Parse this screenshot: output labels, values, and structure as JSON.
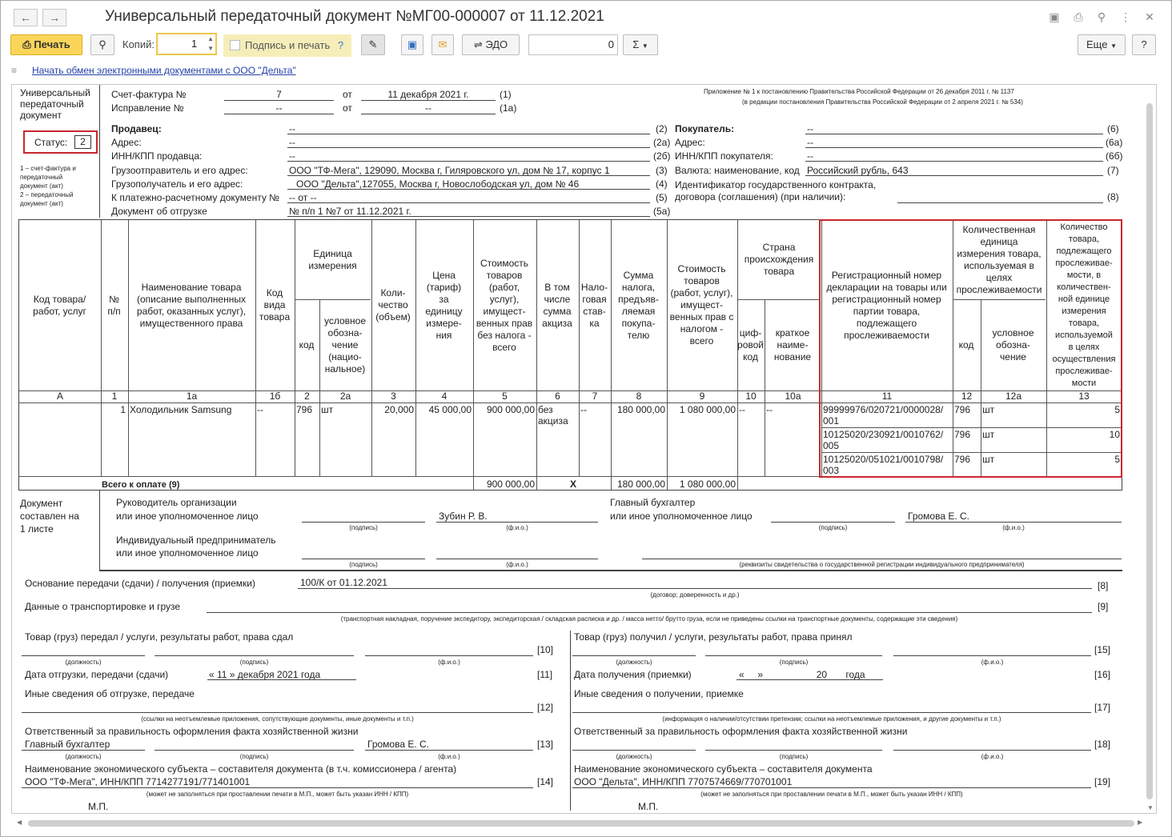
{
  "window": {
    "title": "Универсальный передаточный документ №МГ00-000007 от 11.12.2021"
  },
  "toolbar": {
    "print": "Печать",
    "copies_label": "Копий:",
    "copies_value": "1",
    "sign_print": "Подпись и печать",
    "help_q": "?",
    "edo": "ЭДО",
    "counter": "0",
    "sigma": "Σ",
    "more": "Еще",
    "help": "?"
  },
  "link": "Начать обмен электронными документами с ООО \"Дельта\"",
  "doc": {
    "left_caption": "Универсальный\nпередаточный\nдокумент",
    "status_label": "Статус:",
    "status_value": "2",
    "status_note": "1 – счет-фактура и\nпередаточный\nдокумент (акт)\n2 – передаточный\nдокумент (акт)",
    "appendix1": "Приложение № 1 к постановлению Правительства Российской Федерации от 26 декабря 2011 г. № 1137",
    "appendix2": "(в редакции постановления Правительства Российской Федерации от 2 апреля 2021 г. № 534)",
    "inv_label": "Счет-фактура №",
    "inv_num": "7",
    "ot": "от",
    "inv_date": "11 декабря 2021 г.",
    "n1": "(1)",
    "corr_label": "Исправление №",
    "corr_num": "--",
    "corr_date": "--",
    "n1a": "(1а)",
    "seller_label": "Продавец:",
    "seller": "--",
    "n2": "(2)",
    "addr_label": "Адрес:",
    "addr": "--",
    "n2a": "(2а)",
    "inn_label": "ИНН/КПП продавца:",
    "inn": "--",
    "n2b": "(2б)",
    "shipper_label": "Грузоотправитель и его адрес:",
    "shipper": "ООО \"ТФ-Мега\", 129090, Москва г, Гиляровского ул, дом № 17, корпус 1",
    "n3": "(3)",
    "consignee_label": "Грузополучатель и его адрес:",
    "consignee": "ООО \"Дельта\",127055, Москва г, Новослободская ул, дом № 46",
    "n4": "(4)",
    "payment_label": "К платежно-расчетному документу №",
    "payment": "-- от --",
    "n5": "(5)",
    "shipdoc_label": "Документ об отгрузке",
    "shipdoc": "№ п/п 1 №7 от 11.12.2021 г.",
    "n5a": "(5а)",
    "buyer_label": "Покупатель:",
    "buyer": "--",
    "n6": "(6)",
    "baddr_label": "Адрес:",
    "baddr": "--",
    "n6a": "(6а)",
    "binn_label": "ИНН/КПП покупателя:",
    "binn": "--",
    "n6b": "(6б)",
    "currency_label": "Валюта: наименование, код",
    "currency": "Российский рубль, 643",
    "n7": "(7)",
    "gov_label1": "Идентификатор государственного контракта,",
    "gov_label2": "договора (соглашения) (при наличии):",
    "n8": "(8)"
  },
  "table": {
    "h_code": "Код товара/\nработ, услуг",
    "h_num": "№\nп/п",
    "h_name": "Наименование товара\n(описание выполненных\nработ, оказанных услуг),\nимущественного права",
    "h_kind": "Код\nвида\nтовара",
    "h_unit": "Единица\nизмерения",
    "h_unit_code": "код",
    "h_unit_name": "условное\nобозна-\nчение\n(нацио-\nнальное)",
    "h_qty": "Коли-\nчество\n(объем)",
    "h_price": "Цена\n(тариф)\nза\nединицу\nизмере-\nния",
    "h_cost": "Стоимость\nтоваров\n(работ,\nуслуг),\nимущест-\nвенных прав\nбез налога -\nвсего",
    "h_excise": "В том\nчисле\nсумма\nакциза",
    "h_rate": "Нало-\nговая\nстав-\nка",
    "h_tax": "Сумма\nналога,\nпредъяв-\nляемая\nпокупа-\nтелю",
    "h_total": "Стоимость\nтоваров\n(работ, услуг),\nимущест-\nвенных прав с\nналогом -\nвсего",
    "h_country": "Страна\nпроисхождения\nтовара",
    "h_ccode": "циф-\nровой\nкод",
    "h_cname": "краткое\nнаиме-\nнование",
    "h_reg": "Регистрационный номер\nдекларации на товары или\nрегистрационный номер\nпартии товара,\nподлежащего\nпрослеживаемости",
    "h_qunit": "Количественная\nединица\nизмерения товара,\nиспользуемая в\nцелях\nпрослеживаемости",
    "h_qcode": "код",
    "h_qname": "условное\nобозна-\nчение",
    "h_tqty": "Количество\nтовара,\nподлежащего\nпрослеживае-\nмости, в\nколичествен-\nной единице\nизмерения\nтовара,\nиспользуемой\nв целях\nосуществления\nпрослеживае-\nмости",
    "idx": [
      "А",
      "1",
      "1а",
      "1б",
      "2",
      "2а",
      "3",
      "4",
      "5",
      "6",
      "7",
      "8",
      "9",
      "10",
      "10а",
      "11",
      "12",
      "12а",
      "13"
    ],
    "row": {
      "num": "1",
      "name": "Холодильник Samsung",
      "kind": "--",
      "ucode": "796",
      "uname": "шт",
      "qty": "20,000",
      "price": "45 000,00",
      "cost": "900 000,00",
      "excise": "без\nакциза",
      "rate": "--",
      "tax": "180 000,00",
      "total": "1 080 000,00",
      "ccode": "--",
      "cname": "--"
    },
    "trace": [
      {
        "reg": "99999976/020721/0000028/\n001",
        "code": "796",
        "name": "шт",
        "qty": "5"
      },
      {
        "reg": "10125020/230921/0010762/\n005",
        "code": "796",
        "name": "шт",
        "qty": "10"
      },
      {
        "reg": "10125020/051021/0010798/\n003",
        "code": "796",
        "name": "шт",
        "qty": "5"
      }
    ],
    "total_label": "Всего к оплате (9)",
    "total_cost": "900 000,00",
    "total_x": "X",
    "total_tax": "180 000,00",
    "total_sum": "1 080 000,00"
  },
  "sign": {
    "doc_sheets": "Документ\nсоставлен на\n1 листе",
    "head1": "Руководитель организации",
    "head2": "или иное уполномоченное лицо",
    "head_name": "Зубин Р. В.",
    "acc1": "Главный бухгалтер",
    "acc2": "или иное уполномоченное лицо",
    "acc_name": "Громова Е. С.",
    "ip1": "Индивидуальный предприниматель",
    "ip2": "или иное уполномоченное лицо",
    "podpis": "(подпись)",
    "fio": "(ф.и.о.)",
    "dolzh": "(должность)",
    "ip_note": "(реквизиты свидетельства о государственной  регистрации индивидуального предпринимателя)"
  },
  "bottom": {
    "basis_label": "Основание передачи (сдачи) / получения (приемки)",
    "basis": "100/К от 01.12.2021",
    "b8": "[8]",
    "basis_note": "(договор; доверенность и др.)",
    "transport_label": "Данные о транспортировке и грузе",
    "b9": "[9]",
    "transport_note": "(транспортная накладная, поручение экспедитору, экспедиторская / складская расписка и др. / масса нетто/ брутто груза, если не приведены ссылки на транспортные документы, содержащие эти сведения)",
    "gave_label": "Товар (груз) передал / услуги, результаты работ, права сдал",
    "b10": "[10]",
    "ship_date_label": "Дата отгрузки, передачи (сдачи)",
    "ship_date": "« 11 »   декабря  2021  года",
    "b11": "[11]",
    "other_ship_label": "Иные сведения об отгрузке, передаче",
    "b12": "[12]",
    "other_ship_note": "(ссылки на неотъемлемые приложения, сопутствующие документы, иные документы и т.п.)",
    "resp_label": "Ответственный за правильность оформления факта хозяйственной жизни",
    "resp_pos": "Главный бухгалтер",
    "resp_name": "Громова Е. С.",
    "b13": "[13]",
    "entity_label": "Наименование экономического субъекта – составителя документа (в т.ч. комиссионера / агента)",
    "entity": "ООО \"ТФ-Мега\", ИНН/КПП 7714277191/771401001",
    "b14": "[14]",
    "entity_note": "(может не заполняться при проставлении печати в М.П., может быть указан ИНН / КПП)",
    "mp": "М.П.",
    "got_label": "Товар (груз) получил / услуги, результаты работ, права принял",
    "b15": "[15]",
    "recv_date_label": "Дата получения (приемки)",
    "recv_date": "«     »                    20       года",
    "b16": "[16]",
    "other_recv_label": "Иные сведения о получении, приемке",
    "b17": "[17]",
    "other_recv_note": "(информация о наличии/отсутствии претензии; ссылки на неотъемлемые приложения, и другие  документы и т.п.)",
    "resp2_label": "Ответственный за правильность оформления факта хозяйственной жизни",
    "b18": "[18]",
    "entity2_label": "Наименование экономического субъекта – составителя документа",
    "entity2": "ООО \"Дельта\", ИНН/КПП 7707574669/770701001",
    "b19": "[19]"
  }
}
